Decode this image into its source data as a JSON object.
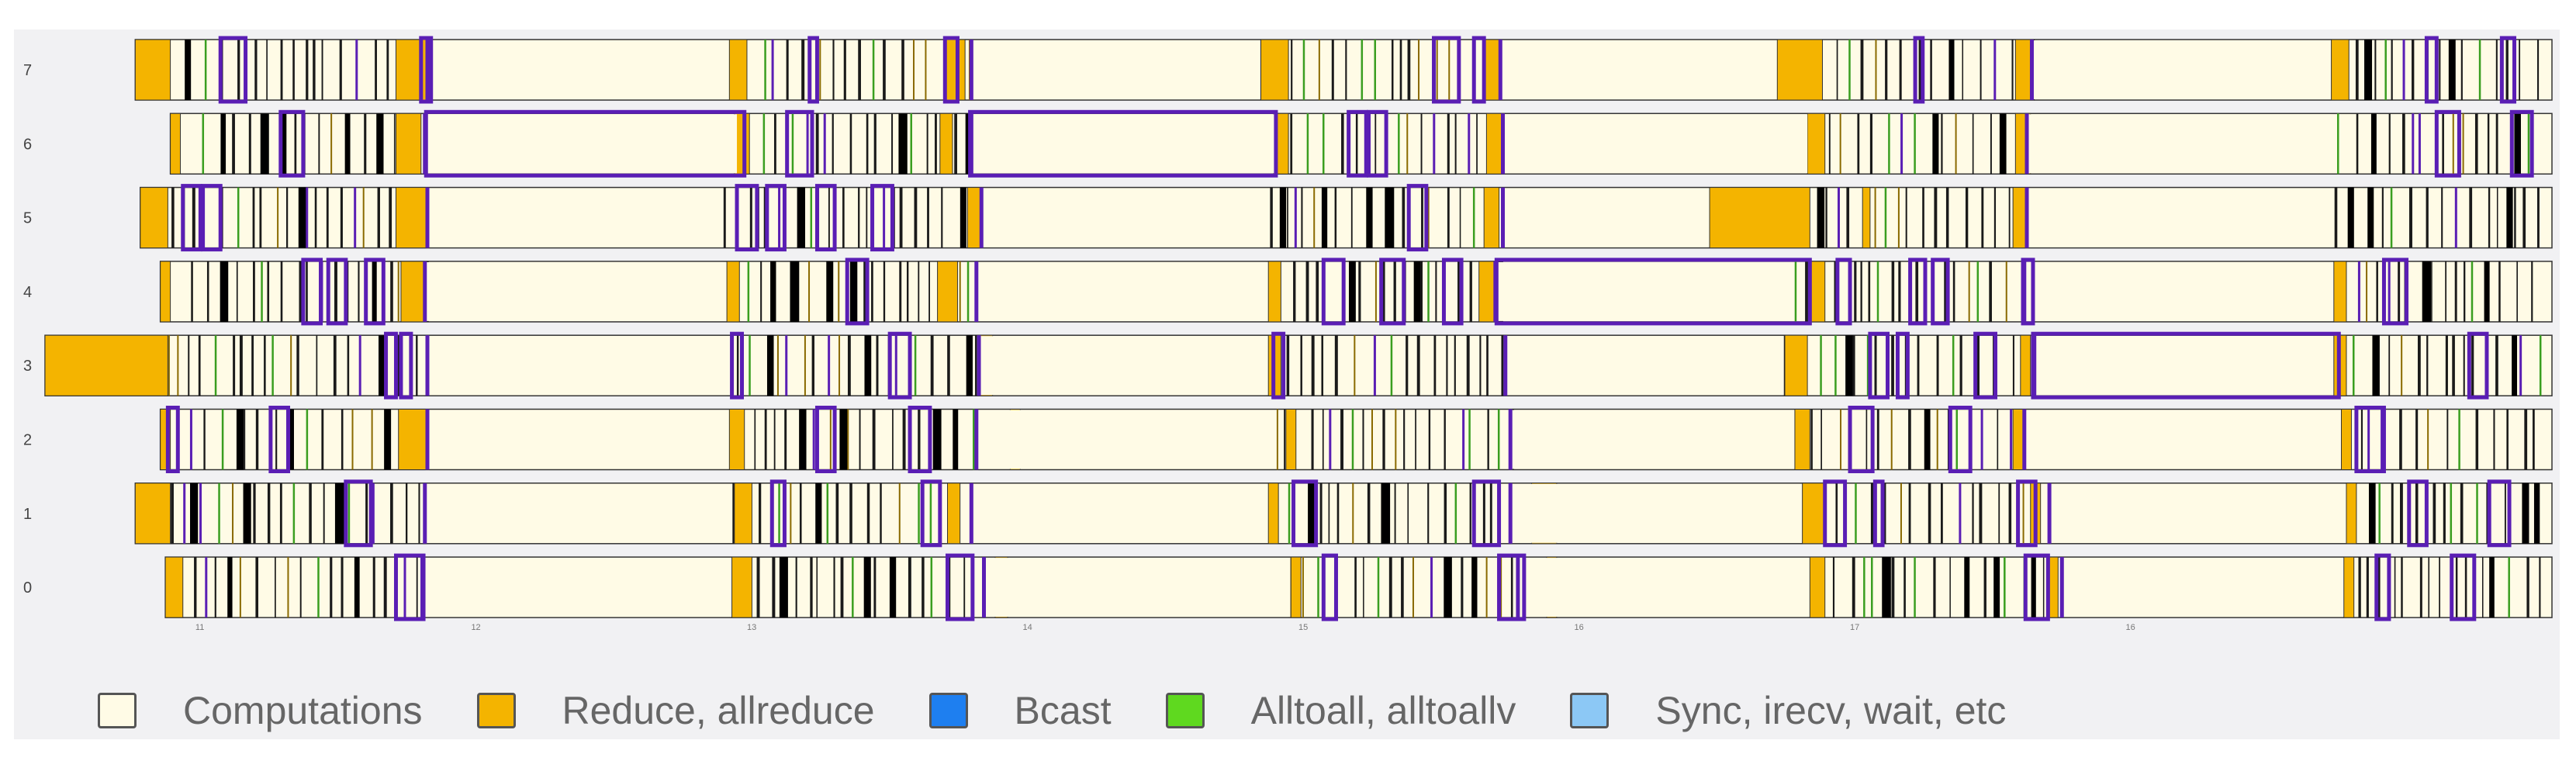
{
  "chart_data": {
    "type": "timeline",
    "x_range": [
      0,
      100
    ],
    "ranks": [
      "0",
      "1",
      "2",
      "3",
      "4",
      "5",
      "6",
      "7"
    ],
    "x_ticks": [
      {
        "x": 6,
        "label": "11"
      },
      {
        "x": 17,
        "label": "12"
      },
      {
        "x": 28,
        "label": "13"
      },
      {
        "x": 39,
        "label": "14"
      },
      {
        "x": 50,
        "label": "15"
      },
      {
        "x": 61,
        "label": "16"
      },
      {
        "x": 72,
        "label": "17"
      },
      {
        "x": 83,
        "label": "16"
      }
    ],
    "colors": {
      "computation": "#fffbe6",
      "reduce": "#f4b400",
      "dense": "#000000",
      "alltoall": "#3a9e20",
      "highlight": "#5a1eb4",
      "bcast": "#1e7ff0",
      "sync": "#8cc8f5"
    },
    "rows": [
      {
        "rank": "0",
        "start": 4.8,
        "reduce": [
          [
            4.8,
            5.5
          ],
          [
            27.4,
            28.2
          ],
          [
            37.9,
            38.4
          ],
          [
            49.7,
            50.1
          ],
          [
            59.9,
            60.3
          ],
          [
            70.4,
            71.0
          ],
          [
            79.9,
            80.3
          ],
          [
            91.7,
            92.1
          ]
        ],
        "computation": [
          [
            15.1,
            27.3
          ],
          [
            37.5,
            49.6
          ],
          [
            58.8,
            70.3
          ],
          [
            80.5,
            91.6
          ]
        ],
        "boxes": [
          [
            14.0,
            15.1
          ],
          [
            36.0,
            37.0
          ],
          [
            51.0,
            51.5
          ],
          [
            58.0,
            59.0
          ],
          [
            79.0,
            79.9
          ],
          [
            93.0,
            93.5
          ],
          [
            96.0,
            96.9
          ]
        ]
      },
      {
        "rank": "1",
        "start": 3.6,
        "reduce": [
          [
            3.6,
            5.0
          ],
          [
            27.5,
            28.2
          ],
          [
            36.0,
            36.5
          ],
          [
            48.8,
            49.2
          ],
          [
            59.3,
            60.3
          ],
          [
            70.1,
            71.0
          ],
          [
            79.2,
            79.6
          ],
          [
            91.8,
            92.2
          ]
        ],
        "computation": [
          [
            15.2,
            27.4
          ],
          [
            37.0,
            48.7
          ],
          [
            58.5,
            70.0
          ],
          [
            80.0,
            91.7
          ]
        ],
        "boxes": [
          [
            12.0,
            13.0
          ],
          [
            29.0,
            29.5
          ],
          [
            35.0,
            35.7
          ],
          [
            49.8,
            50.7
          ],
          [
            57.0,
            58.0
          ],
          [
            71.0,
            71.8
          ],
          [
            73.0,
            73.3
          ],
          [
            78.7,
            79.4
          ],
          [
            94.3,
            95.0
          ],
          [
            97.5,
            98.3
          ]
        ]
      },
      {
        "rank": "2",
        "start": 4.6,
        "reduce": [
          [
            4.6,
            5.0
          ],
          [
            14.1,
            15.2
          ],
          [
            27.3,
            27.9
          ],
          [
            38.5,
            38.9
          ],
          [
            49.5,
            49.9
          ],
          [
            69.8,
            70.4
          ],
          [
            78.5,
            78.9
          ],
          [
            91.6,
            92.0
          ]
        ],
        "computation": [
          [
            15.3,
            27.2
          ],
          [
            37.2,
            48.9
          ],
          [
            58.5,
            69.7
          ],
          [
            79.0,
            91.5
          ]
        ],
        "boxes": [
          [
            4.9,
            5.3
          ],
          [
            9.0,
            9.7
          ],
          [
            30.8,
            31.5
          ],
          [
            34.5,
            35.3
          ],
          [
            72.0,
            72.9
          ],
          [
            76.0,
            76.8
          ],
          [
            92.2,
            93.3
          ]
        ]
      },
      {
        "rank": "3",
        "start": 0.0,
        "reduce": [
          [
            0.0,
            4.9
          ],
          [
            37.2,
            37.8
          ],
          [
            48.8,
            49.3
          ],
          [
            69.4,
            70.3
          ],
          [
            78.8,
            79.2
          ],
          [
            91.3,
            91.8
          ]
        ],
        "computation": [
          [
            15.3,
            27.2
          ],
          [
            37.3,
            48.7
          ],
          [
            58.3,
            69.3
          ],
          [
            79.4,
            91.2
          ]
        ],
        "boxes": [
          [
            13.6,
            14.0
          ],
          [
            14.2,
            14.6
          ],
          [
            27.4,
            27.8
          ],
          [
            33.7,
            34.5
          ],
          [
            49.0,
            49.4
          ],
          [
            72.8,
            73.5
          ],
          [
            73.9,
            74.3
          ],
          [
            77.0,
            77.8
          ],
          [
            79.3,
            91.5
          ],
          [
            96.7,
            97.4
          ]
        ]
      },
      {
        "rank": "4",
        "start": 4.6,
        "reduce": [
          [
            4.6,
            5.0
          ],
          [
            14.2,
            15.1
          ],
          [
            27.2,
            27.7
          ],
          [
            35.6,
            36.4
          ],
          [
            48.8,
            49.3
          ],
          [
            57.2,
            57.8
          ],
          [
            70.4,
            71.0
          ],
          [
            91.3,
            91.8
          ]
        ],
        "computation": [
          [
            15.2,
            27.1
          ],
          [
            37.2,
            48.7
          ],
          [
            57.9,
            69.7
          ],
          [
            79.0,
            91.2
          ]
        ],
        "boxes": [
          [
            10.3,
            11.0
          ],
          [
            11.3,
            12.0
          ],
          [
            12.8,
            13.5
          ],
          [
            32.0,
            32.8
          ],
          [
            51.0,
            51.8
          ],
          [
            53.3,
            54.2
          ],
          [
            55.8,
            56.5
          ],
          [
            57.9,
            70.4
          ],
          [
            71.5,
            72.0
          ],
          [
            74.4,
            75.0
          ],
          [
            75.3,
            75.9
          ],
          [
            78.9,
            79.3
          ],
          [
            93.3,
            94.2
          ]
        ]
      },
      {
        "rank": "5",
        "start": 3.8,
        "reduce": [
          [
            3.8,
            4.9
          ],
          [
            14.0,
            15.2
          ],
          [
            36.8,
            37.3
          ],
          [
            57.4,
            58.0
          ],
          [
            66.4,
            70.4
          ],
          [
            72.5,
            72.8
          ],
          [
            78.5,
            79.0
          ]
        ],
        "computation": [
          [
            15.3,
            27.0
          ],
          [
            37.4,
            48.6
          ],
          [
            58.2,
            66.3
          ],
          [
            79.1,
            91.2
          ]
        ],
        "boxes": [
          [
            5.5,
            6.2
          ],
          [
            6.3,
            7.0
          ],
          [
            27.6,
            28.4
          ],
          [
            28.8,
            29.5
          ],
          [
            30.8,
            31.5
          ],
          [
            33.0,
            33.8
          ],
          [
            54.4,
            55.1
          ]
        ]
      },
      {
        "rank": "6",
        "start": 5.0,
        "reduce": [
          [
            5.0,
            5.4
          ],
          [
            14.0,
            15.0
          ],
          [
            27.5,
            28.1
          ],
          [
            35.7,
            36.2
          ],
          [
            49.0,
            49.6
          ],
          [
            57.5,
            58.1
          ],
          [
            70.3,
            71.0
          ],
          [
            78.6,
            79.2
          ]
        ],
        "computation": [
          [
            15.2,
            27.6
          ],
          [
            37.0,
            49.1
          ],
          [
            58.2,
            70.3
          ],
          [
            79.1,
            91.2
          ]
        ],
        "boxes": [
          [
            9.4,
            10.3
          ],
          [
            15.2,
            27.9
          ],
          [
            29.6,
            30.6
          ],
          [
            36.9,
            49.1
          ],
          [
            52.0,
            52.7
          ],
          [
            52.8,
            53.5
          ],
          [
            95.4,
            96.3
          ],
          [
            98.4,
            99.2
          ]
        ]
      },
      {
        "rank": "7",
        "start": 3.6,
        "reduce": [
          [
            3.6,
            5.0
          ],
          [
            14.0,
            15.2
          ],
          [
            27.3,
            28.0
          ],
          [
            35.9,
            36.7
          ],
          [
            48.5,
            49.6
          ],
          [
            57.4,
            58.0
          ],
          [
            69.1,
            70.9
          ],
          [
            78.6,
            79.2
          ],
          [
            91.2,
            91.9
          ]
        ],
        "computation": [
          [
            15.3,
            27.2
          ],
          [
            37.0,
            48.4
          ],
          [
            58.1,
            69.0
          ],
          [
            79.3,
            91.1
          ]
        ],
        "boxes": [
          [
            7.0,
            8.0
          ],
          [
            15.0,
            15.4
          ],
          [
            30.5,
            30.8
          ],
          [
            35.9,
            36.4
          ],
          [
            55.4,
            56.4
          ],
          [
            57.0,
            57.4
          ],
          [
            74.6,
            74.9
          ],
          [
            95.0,
            95.4
          ],
          [
            98.0,
            98.5
          ]
        ]
      }
    ]
  },
  "legend": [
    {
      "label": "Computations",
      "color": "#fffbe6"
    },
    {
      "label": "Reduce, allreduce",
      "color": "#f4b400"
    },
    {
      "label": "Bcast",
      "color": "#1e7ff0"
    },
    {
      "label": "Alltoall, alltoallv",
      "color": "#5fd91f"
    },
    {
      "label": "Sync, irecv, wait, etc",
      "color": "#8cc8f5"
    }
  ]
}
